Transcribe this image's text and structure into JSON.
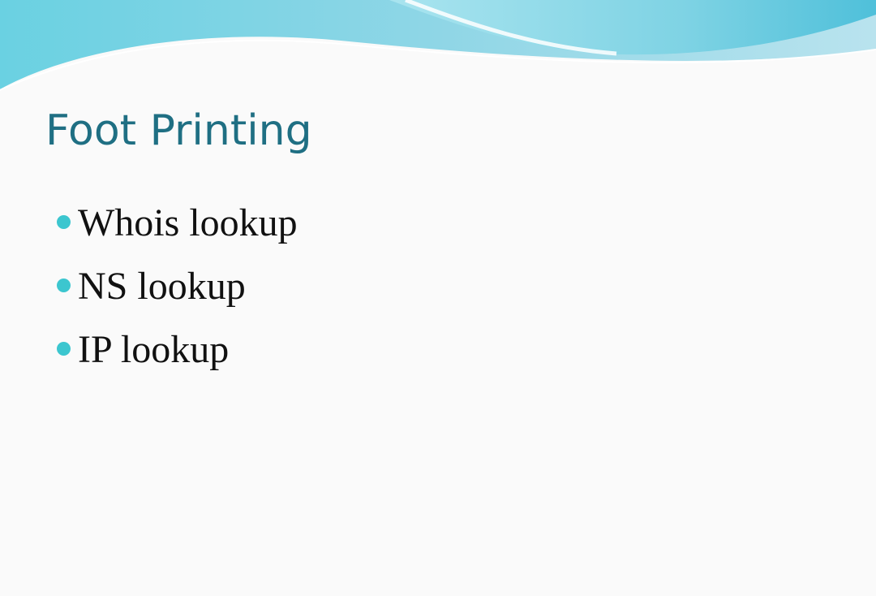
{
  "slide": {
    "title": "Foot Printing",
    "bullets": [
      {
        "text": "Whois lookup"
      },
      {
        "text": "NS lookup"
      },
      {
        "text": "IP lookup"
      }
    ]
  },
  "colors": {
    "title": "#1f6f83",
    "bullet": "#3cc6cf",
    "background": "#fafafa",
    "wave_dark": "#5fc9df",
    "wave_light": "#bfe8ef"
  }
}
